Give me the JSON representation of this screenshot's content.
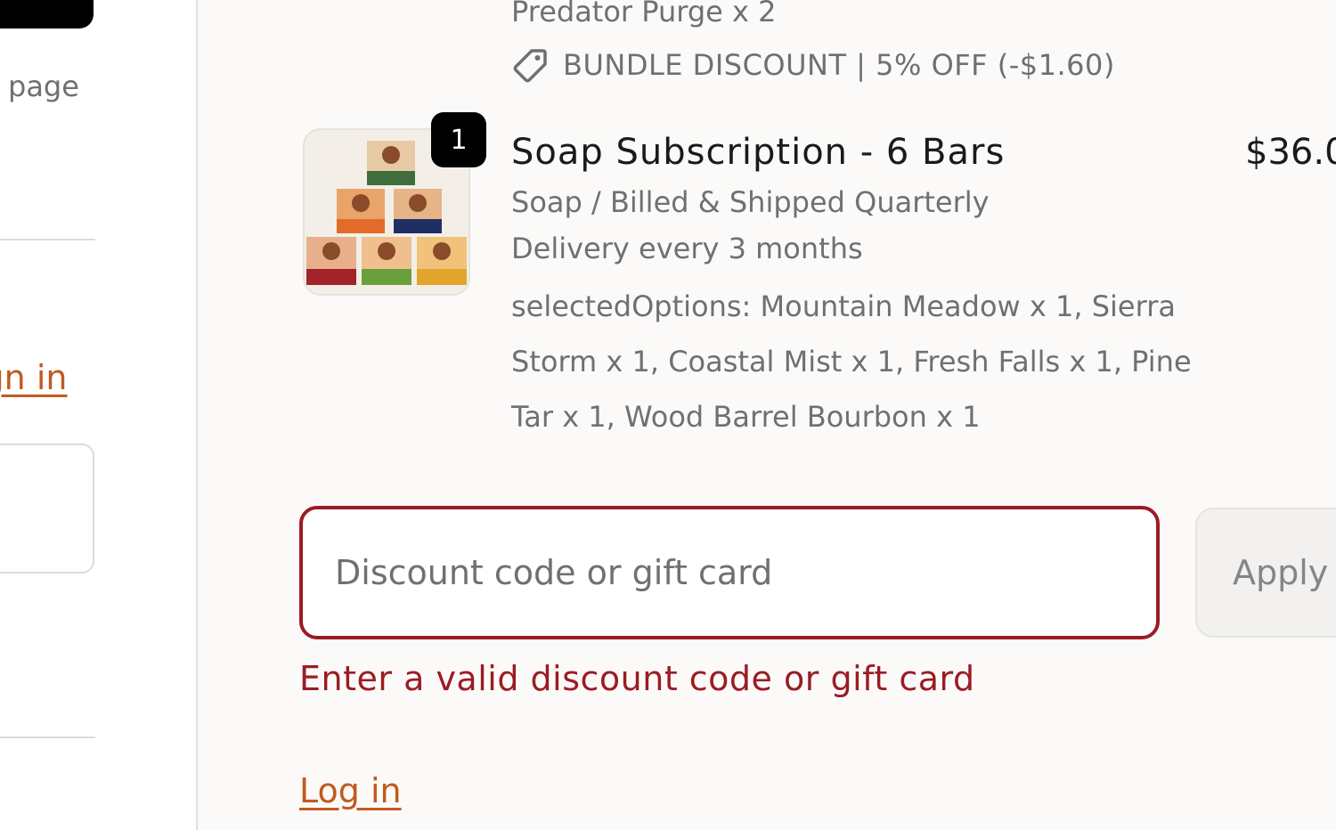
{
  "left": {
    "page_text": "page",
    "sign_in_link": "ign in"
  },
  "summary": {
    "previous_item": {
      "variant": "Predator Purge x 2",
      "discount": "BUNDLE DISCOUNT | 5% OFF (-$1.60)"
    },
    "item": {
      "quantity": "1",
      "title": "Soap Subscription - 6 Bars",
      "price": "$36.0",
      "variant": "Soap / Billed & Shipped Quarterly",
      "delivery": "Delivery every 3 months",
      "options": "selectedOptions: Mountain Meadow x 1, Sierra Storm x 1, Coastal Mist x 1, Fresh Falls x 1, Pine Tar x 1, Wood Barrel Bourbon x 1"
    },
    "discount_field": {
      "placeholder": "Discount code or gift card",
      "value": ""
    },
    "apply_label": "Apply",
    "error_message": "Enter a valid discount code or gift card",
    "login_link": "Log in"
  },
  "colors": {
    "error": "#9b1c24",
    "link": "#c25a1f",
    "summary_bg": "#fbfaf9"
  }
}
